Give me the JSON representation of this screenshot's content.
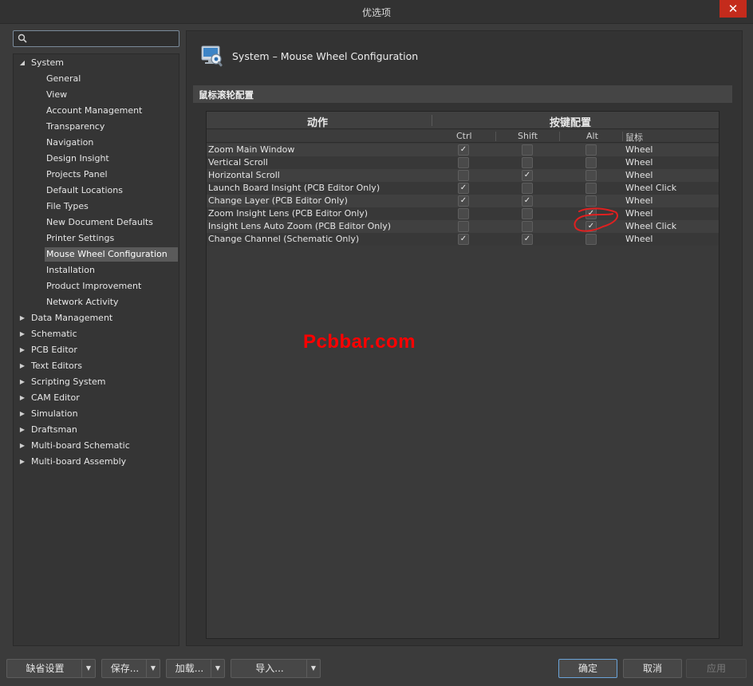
{
  "window": {
    "title": "优选项",
    "close_glyph": "✕"
  },
  "search": {
    "placeholder": ""
  },
  "tree": [
    {
      "label": "System",
      "expanded": true,
      "level": 0
    },
    {
      "label": "General",
      "level": 1
    },
    {
      "label": "View",
      "level": 1
    },
    {
      "label": "Account Management",
      "level": 1
    },
    {
      "label": "Transparency",
      "level": 1
    },
    {
      "label": "Navigation",
      "level": 1
    },
    {
      "label": "Design Insight",
      "level": 1
    },
    {
      "label": "Projects Panel",
      "level": 1
    },
    {
      "label": "Default Locations",
      "level": 1
    },
    {
      "label": "File Types",
      "level": 1
    },
    {
      "label": "New Document Defaults",
      "level": 1
    },
    {
      "label": "Printer Settings",
      "level": 1
    },
    {
      "label": "Mouse Wheel Configuration",
      "level": 1,
      "selected": true
    },
    {
      "label": "Installation",
      "level": 1
    },
    {
      "label": "Product Improvement",
      "level": 1
    },
    {
      "label": "Network Activity",
      "level": 1
    },
    {
      "label": "Data Management",
      "level": 0
    },
    {
      "label": "Schematic",
      "level": 0
    },
    {
      "label": "PCB Editor",
      "level": 0
    },
    {
      "label": "Text Editors",
      "level": 0
    },
    {
      "label": "Scripting System",
      "level": 0
    },
    {
      "label": "CAM Editor",
      "level": 0
    },
    {
      "label": "Simulation",
      "level": 0
    },
    {
      "label": "Draftsman",
      "level": 0
    },
    {
      "label": "Multi-board Schematic",
      "level": 0
    },
    {
      "label": "Multi-board Assembly",
      "level": 0
    }
  ],
  "page": {
    "title": "System – Mouse Wheel Configuration",
    "section": "鼠标滚轮配置",
    "icon": "mouse-settings-icon"
  },
  "grid": {
    "header_action": "动作",
    "header_keys": "按键配置",
    "col_ctrl": "Ctrl",
    "col_shift": "Shift",
    "col_alt": "Alt",
    "col_mouse": "鼠标",
    "rows": [
      {
        "action": "Zoom Main Window",
        "ctrl": true,
        "shift": false,
        "alt": false,
        "mouse": "Wheel"
      },
      {
        "action": "Vertical Scroll",
        "ctrl": false,
        "shift": false,
        "alt": false,
        "mouse": "Wheel"
      },
      {
        "action": "Horizontal Scroll",
        "ctrl": false,
        "shift": true,
        "alt": false,
        "mouse": "Wheel"
      },
      {
        "action": "Launch Board Insight  (PCB Editor Only)",
        "ctrl": true,
        "shift": false,
        "alt": false,
        "mouse": "Wheel Click"
      },
      {
        "action": "Change Layer  (PCB Editor Only)",
        "ctrl": true,
        "shift": true,
        "alt": false,
        "mouse": "Wheel"
      },
      {
        "action": "Zoom Insight Lens  (PCB Editor Only)",
        "ctrl": false,
        "shift": false,
        "alt": true,
        "mouse": "Wheel"
      },
      {
        "action": "Insight Lens Auto Zoom  (PCB Editor Only)",
        "ctrl": false,
        "shift": false,
        "alt": true,
        "mouse": "Wheel Click"
      },
      {
        "action": "Change Channel  (Schematic Only)",
        "ctrl": true,
        "shift": true,
        "alt": false,
        "mouse": "Wheel"
      }
    ]
  },
  "watermark": "Pcbbar.com",
  "annotation_color": "#e02020",
  "footer": {
    "defaults": "缺省设置",
    "save": "保存...",
    "load": "加载...",
    "import": "导入...",
    "ok": "确定",
    "cancel": "取消",
    "apply": "应用"
  },
  "colors": {
    "accent": "#6aa3d8",
    "close": "#c42b1c",
    "selection": "#5a5a5a"
  }
}
